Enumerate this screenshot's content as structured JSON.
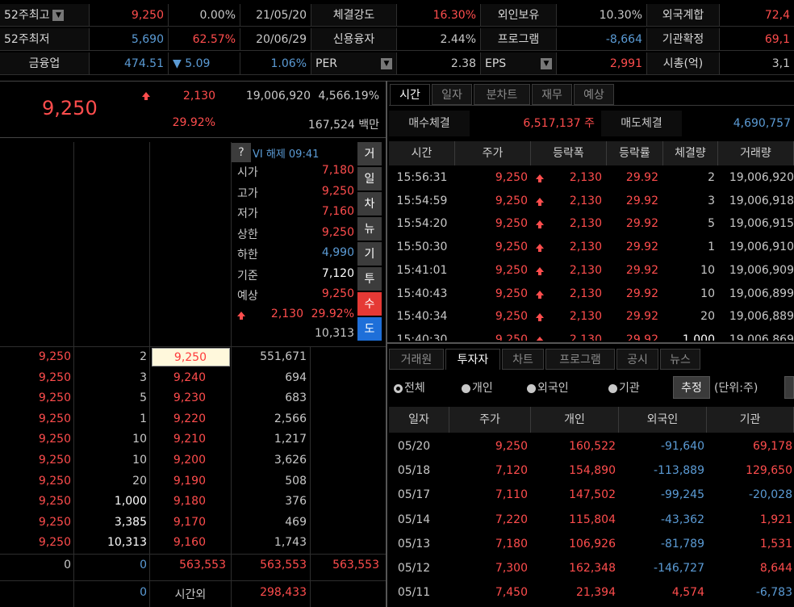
{
  "top": {
    "row1": {
      "label1": "52주최고",
      "high_price": "9,250",
      "high_pct": "0.00%",
      "high_date": "21/05/20",
      "label2": "체결강도",
      "strength": "16.30%",
      "label3": "외인보유",
      "foreign_hold": "10.30%",
      "label4": "외국계합",
      "foreign_sum": "72,4"
    },
    "row2": {
      "label1": "52주최저",
      "low_price": "5,690",
      "low_pct": "62.57%",
      "low_date": "20/06/29",
      "label2": "신용융자",
      "credit": "2.44%",
      "label3": "프로그램",
      "program": "-8,664",
      "label4": "기관확정",
      "inst_confirm": "69,1"
    },
    "row3": {
      "label1": "금융업",
      "sector_val": "474.51",
      "sector_change": "▼ 5.09",
      "sector_pct": "1.06%",
      "label2": "PER",
      "per": "2.38",
      "label3": "EPS",
      "eps": "2,991",
      "label4": "시총(억)",
      "mcap": "3,1"
    }
  },
  "price": {
    "current": "9,250",
    "change": "2,130",
    "volume": "19,006,920",
    "turnover_ratio": "4,566.19%",
    "change_pct": "29.92%",
    "amount": "167,524 백만"
  },
  "info": {
    "help": "?",
    "vi": "VI 해제 09:41",
    "rows": [
      {
        "label": "시가",
        "value": "7,180",
        "color": "red"
      },
      {
        "label": "고가",
        "value": "9,250",
        "color": "red"
      },
      {
        "label": "저가",
        "value": "7,160",
        "color": "red"
      },
      {
        "label": "상한",
        "value": "9,250",
        "color": "red"
      },
      {
        "label": "하한",
        "value": "4,990",
        "color": "blue"
      },
      {
        "label": "기준",
        "value": "7,120",
        "color": "white"
      },
      {
        "label": "예상",
        "value": "9,250",
        "color": "red"
      }
    ],
    "exp_change": "2,130",
    "exp_pct": "29.92%",
    "exp_qty": "10,313",
    "side_buttons": [
      "거",
      "일",
      "차",
      "뉴",
      "기",
      "투",
      "수",
      "도"
    ]
  },
  "trades": [
    {
      "price": "9,250",
      "qty": "2",
      "level": "9,250",
      "cum": "551,671",
      "qty_white": false
    },
    {
      "price": "9,250",
      "qty": "3",
      "level": "9,240",
      "cum": "694",
      "qty_white": false
    },
    {
      "price": "9,250",
      "qty": "5",
      "level": "9,230",
      "cum": "683",
      "qty_white": false
    },
    {
      "price": "9,250",
      "qty": "1",
      "level": "9,220",
      "cum": "2,566",
      "qty_white": false
    },
    {
      "price": "9,250",
      "qty": "10",
      "level": "9,210",
      "cum": "1,217",
      "qty_white": false
    },
    {
      "price": "9,250",
      "qty": "10",
      "level": "9,200",
      "cum": "3,626",
      "qty_white": false
    },
    {
      "price": "9,250",
      "qty": "20",
      "level": "9,190",
      "cum": "508",
      "qty_white": false
    },
    {
      "price": "9,250",
      "qty": "1,000",
      "level": "9,180",
      "cum": "376",
      "qty_white": true
    },
    {
      "price": "9,250",
      "qty": "3,385",
      "level": "9,170",
      "cum": "469",
      "qty_white": true
    },
    {
      "price": "9,250",
      "qty": "10,313",
      "level": "9,160",
      "cum": "1,743",
      "qty_white": true
    }
  ],
  "totals": {
    "a": "0",
    "b": "0",
    "c": "563,553",
    "d": "563,553",
    "e": "563,553",
    "f": "0",
    "after_label": "시간외",
    "after_val": "298,433"
  },
  "right_tabs": [
    "시간",
    "일자",
    "분차트",
    "재무",
    "예상"
  ],
  "exec": {
    "buy_label": "매수체결",
    "buy_val": "6,517,137 주",
    "sell_label": "매도체결",
    "sell_val": "4,690,757"
  },
  "tick_headers": [
    "시간",
    "주가",
    "등락폭",
    "등락률",
    "체결량",
    "거래량"
  ],
  "ticks": [
    {
      "time": "15:56:31",
      "price": "9,250",
      "chg": "2,130",
      "pct": "29.92",
      "qty": "2",
      "vol": "19,006,920",
      "qty_white": false
    },
    {
      "time": "15:54:59",
      "price": "9,250",
      "chg": "2,130",
      "pct": "29.92",
      "qty": "3",
      "vol": "19,006,918",
      "qty_white": false
    },
    {
      "time": "15:54:20",
      "price": "9,250",
      "chg": "2,130",
      "pct": "29.92",
      "qty": "5",
      "vol": "19,006,915",
      "qty_white": false
    },
    {
      "time": "15:50:30",
      "price": "9,250",
      "chg": "2,130",
      "pct": "29.92",
      "qty": "1",
      "vol": "19,006,910",
      "qty_white": false
    },
    {
      "time": "15:41:01",
      "price": "9,250",
      "chg": "2,130",
      "pct": "29.92",
      "qty": "10",
      "vol": "19,006,909",
      "qty_white": false
    },
    {
      "time": "15:40:43",
      "price": "9,250",
      "chg": "2,130",
      "pct": "29.92",
      "qty": "10",
      "vol": "19,006,899",
      "qty_white": false
    },
    {
      "time": "15:40:34",
      "price": "9,250",
      "chg": "2,130",
      "pct": "29.92",
      "qty": "20",
      "vol": "19,006,889",
      "qty_white": false
    },
    {
      "time": "15:40:30",
      "price": "9,250",
      "chg": "2,130",
      "pct": "29.92",
      "qty": "1,000",
      "vol": "19,006,869",
      "qty_white": true
    }
  ],
  "bottom_tabs": [
    "거래원",
    "투자자",
    "차트",
    "프로그램",
    "공시",
    "뉴스"
  ],
  "filters": {
    "all": "전체",
    "indiv": "개인",
    "foreign": "외국인",
    "inst": "기관",
    "trend_btn": "추정",
    "unit": "(단위:주)"
  },
  "inv_headers": [
    "일자",
    "주가",
    "개인",
    "외국인",
    "기관"
  ],
  "investors": [
    {
      "date": "05/20",
      "price": "9,250",
      "indiv": "160,522",
      "foreign": "-91,640",
      "inst": "69,178"
    },
    {
      "date": "05/18",
      "price": "7,120",
      "indiv": "154,890",
      "foreign": "-113,889",
      "inst": "129,650"
    },
    {
      "date": "05/17",
      "price": "7,110",
      "indiv": "147,502",
      "foreign": "-99,245",
      "inst": "-20,028"
    },
    {
      "date": "05/14",
      "price": "7,220",
      "indiv": "115,804",
      "foreign": "-43,362",
      "inst": "1,921"
    },
    {
      "date": "05/13",
      "price": "7,180",
      "indiv": "106,926",
      "foreign": "-81,789",
      "inst": "1,531"
    },
    {
      "date": "05/12",
      "price": "7,300",
      "indiv": "162,348",
      "foreign": "-146,727",
      "inst": "8,644"
    },
    {
      "date": "05/11",
      "price": "7,450",
      "indiv": "21,394",
      "foreign": "4,574",
      "inst": "-6,783"
    }
  ]
}
